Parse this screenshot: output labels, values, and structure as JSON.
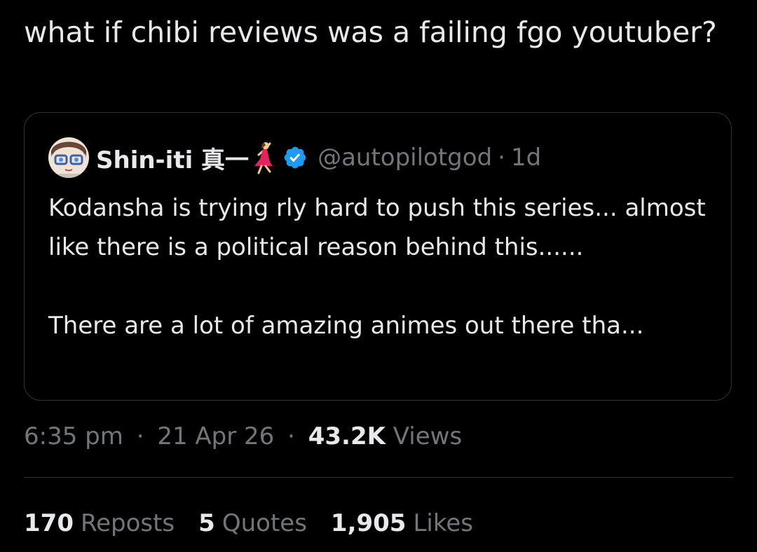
{
  "tweet": {
    "text": "what if chibi reviews was a failing fgo youtuber?"
  },
  "quote": {
    "display_name": "Shin-iti 真一",
    "handle": "@autopilotgod",
    "separator": "·",
    "time": "1d",
    "paragraphs": [
      "Kodansha is trying rly hard to push this series... almost like there is a political reason behind this......",
      "There are a lot of amazing animes out there tha..."
    ],
    "icons": {
      "avatar": "avatar",
      "dancer": "woman-dancing-icon",
      "verified": "verified-badge-icon"
    }
  },
  "meta": {
    "time": "6:35 pm",
    "date": "21 Apr 26",
    "separator": "·",
    "views_count": "43.2K",
    "views_label": "Views"
  },
  "stats": {
    "reposts_count": "170",
    "reposts_label": "Reposts",
    "quotes_count": "5",
    "quotes_label": "Quotes",
    "likes_count": "1,905",
    "likes_label": "Likes"
  },
  "colors": {
    "background": "#000000",
    "text_primary": "#e7e9ea",
    "text_secondary": "#71767b",
    "border": "#2f3336",
    "verified": "#1d9bf0"
  }
}
